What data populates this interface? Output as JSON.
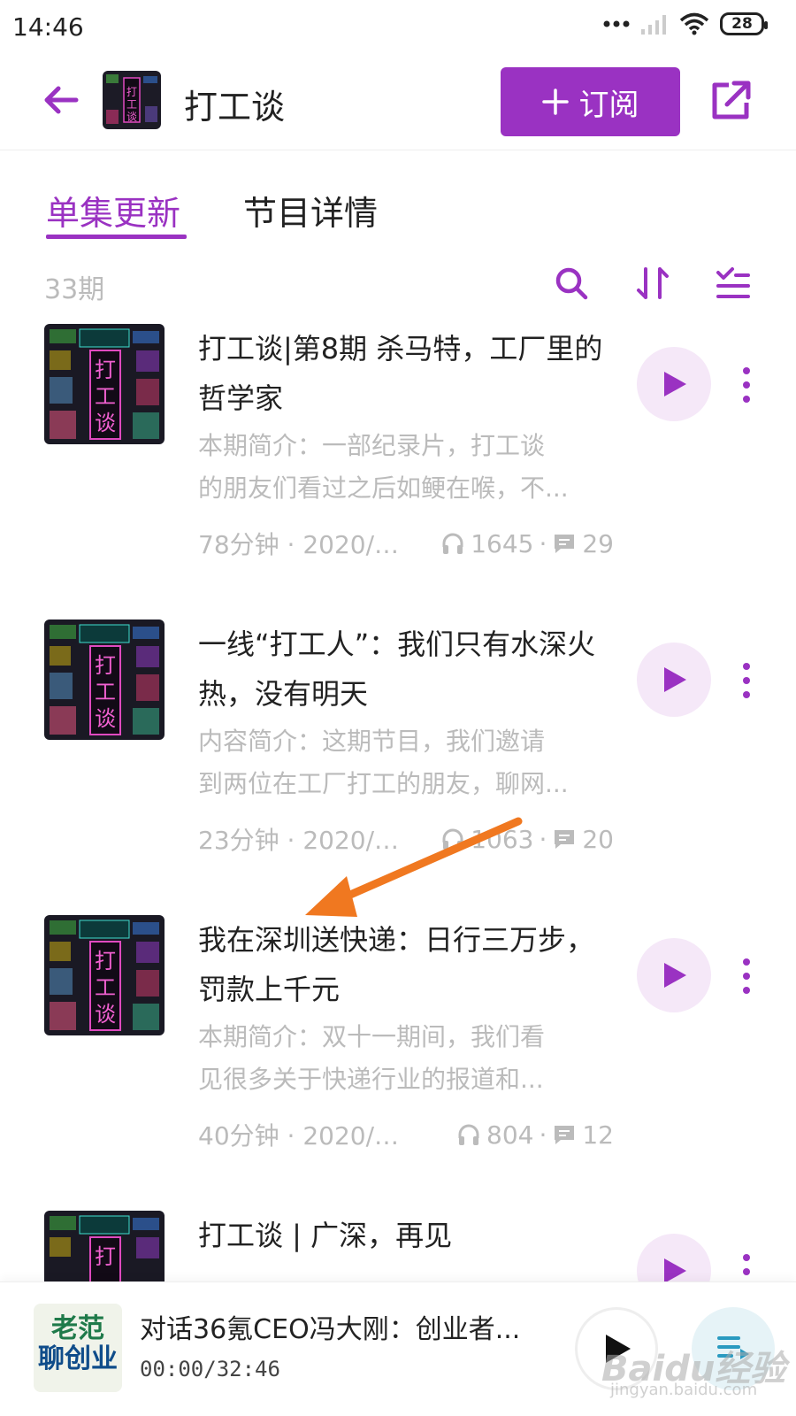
{
  "status_bar": {
    "time": "14:46",
    "battery": "28",
    "icons": [
      "dots-icon",
      "signal-icon",
      "wifi-icon",
      "battery-icon"
    ]
  },
  "header": {
    "title": "打工谈",
    "subscribe_label": "订阅",
    "accent_color": "#9a32c2"
  },
  "tabs": [
    {
      "label": "单集更新",
      "active": true
    },
    {
      "label": "节目详情",
      "active": false
    }
  ],
  "toolbar": {
    "count": "33期",
    "icons": [
      "search-icon",
      "sort-icon",
      "filter-list-icon"
    ]
  },
  "cover_art_text": "打工谈",
  "episodes": [
    {
      "title": "打工谈|第8期 杀马特，工厂里的哲学家",
      "desc_1": "本期简介：一部纪录片，打工谈",
      "desc_2": "的朋友们看过之后如鲠在喉，不...",
      "meta_left": "78分钟 · 2020/1...",
      "listens": "1645",
      "comments": "29"
    },
    {
      "title": "一线“打工人”：我们只有水深火热，没有明天",
      "desc_1": "内容简介：这期节目，我们邀请",
      "desc_2": "到两位在工厂打工的朋友，聊网...",
      "meta_left": "23分钟 · 2020/1...",
      "listens": "1063",
      "comments": "20"
    },
    {
      "title": "我在深圳送快递：日行三万步，罚款上千元",
      "desc_1": "本期简介：双十一期间，我们看",
      "desc_2": "见很多关于快递行业的报道和...",
      "meta_left": "40分钟 · 2020/11/...",
      "listens": "804",
      "comments": "12"
    },
    {
      "title": "打工谈 | 广深，再见",
      "desc_1": "",
      "desc_2": "",
      "meta_left": "",
      "listens": "",
      "comments": ""
    }
  ],
  "player": {
    "title": "对话36氪CEO冯大刚：创业者...",
    "time": "00:00/32:46",
    "cover_line1": "老范",
    "cover_line2": "聊创业"
  },
  "watermark": {
    "main": "Baidu经验",
    "sub": "jingyan.baidu.com"
  }
}
